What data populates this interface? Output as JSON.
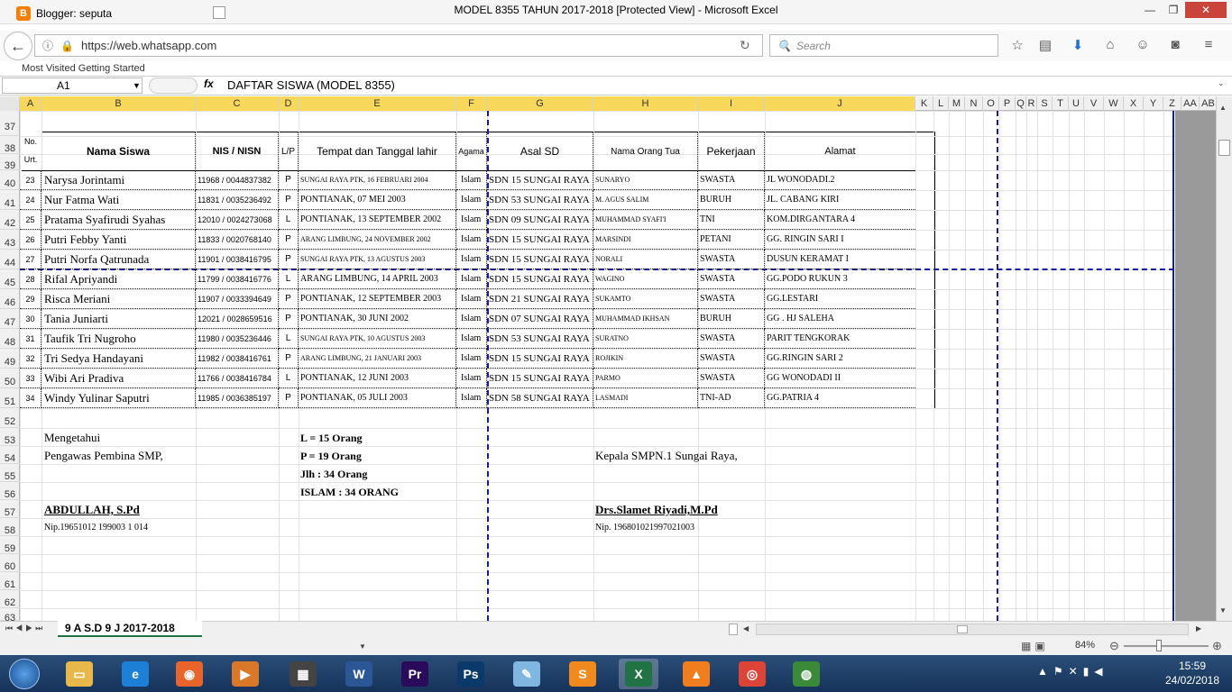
{
  "browser": {
    "tab_title": "Blogger: seputa",
    "url": "https://web.whatsapp.com",
    "search_placeholder": "Search",
    "bookmarks": "Most Visited    Getting Started"
  },
  "window": {
    "title": "MODEL 8355 TAHUN 2017-2018  [Protected View]  -  Microsoft Excel"
  },
  "formula_bar": {
    "cell_ref": "A1",
    "fx": "fx",
    "content": "DAFTAR SISWA (MODEL 8355)"
  },
  "columns": [
    "A",
    "B",
    "C",
    "D",
    "E",
    "F",
    "G",
    "H",
    "I",
    "J",
    "K",
    "L",
    "M",
    "N",
    "O",
    "P",
    "Q",
    "R",
    "S",
    "T",
    "U",
    "V",
    "W",
    "X",
    "Y",
    "Z",
    "AA",
    "AB"
  ],
  "rows": [
    "37",
    "38",
    "39",
    "40",
    "41",
    "42",
    "43",
    "44",
    "45",
    "46",
    "47",
    "48",
    "49",
    "50",
    "51",
    "52",
    "53",
    "54",
    "55",
    "56",
    "57",
    "58",
    "59",
    "60",
    "61",
    "62",
    "63"
  ],
  "table": {
    "headers": {
      "no": "No.",
      "urt": "Urt.",
      "nama": "Nama  Siswa",
      "nis": "NIS / NISN",
      "lp": "L/P",
      "ttl": "Tempat dan Tanggal lahir",
      "agama": "Agama",
      "asal": "Asal SD",
      "ortu": "Nama Orang Tua",
      "pekerjaan": "Pekerjaan",
      "alamat": "Alamat"
    },
    "students": [
      {
        "no": "23",
        "nama": "Narysa Jorintami",
        "nis": "11968 / 0044837382",
        "lp": "P",
        "ttl": "SUNGAI RAYA PTK, 16 FEBRUARI 2004",
        "agama": "Islam",
        "asal": "SDN 15 SUNGAI RAYA",
        "ortu": "SUNARYO",
        "kerja": "SWASTA",
        "alamat": "JL WONODADI.2"
      },
      {
        "no": "24",
        "nama": "Nur Fatma Wati",
        "nis": "11831 / 0035236492",
        "lp": "P",
        "ttl": "PONTIANAK, 07 MEI 2003",
        "agama": "Islam",
        "asal": "SDN 53 SUNGAI RAYA",
        "ortu": "M. AGUS SALIM",
        "kerja": "BURUH",
        "alamat": "JL. CABANG KIRI"
      },
      {
        "no": "25",
        "nama": "Pratama Syafirudi Syahas",
        "nis": "12010 / 0024273068",
        "lp": "L",
        "ttl": "PONTIANAK, 13 SEPTEMBER 2002",
        "agama": "Islam",
        "asal": "SDN 09 SUNGAI RAYA",
        "ortu": "MUHAMMAD SYAFI'I",
        "kerja": "TNI",
        "alamat": "KOM.DIRGANTARA 4"
      },
      {
        "no": "26",
        "nama": "Putri Febby Yanti",
        "nis": "11833 / 0020768140",
        "lp": "P",
        "ttl": "ARANG LIMBUNG, 24 NOVEMBER 2002",
        "agama": "Islam",
        "asal": "SDN 15 SUNGAI RAYA",
        "ortu": "MARSINDI",
        "kerja": "PETANI",
        "alamat": "GG. RINGIN SARI I"
      },
      {
        "no": "27",
        "nama": "Putri Norfa Qatrunada",
        "nis": "11901 / 0038416795",
        "lp": "P",
        "ttl": "SUNGAI RAYA PTK, 13 AGUSTUS 2003",
        "agama": "Islam",
        "asal": "SDN 15 SUNGAI RAYA",
        "ortu": "NORALI",
        "kerja": "SWASTA",
        "alamat": "DUSUN KERAMAT I"
      },
      {
        "no": "28",
        "nama": "Rifal Apriyandi",
        "nis": "11799 / 0038416776",
        "lp": "L",
        "ttl": "ARANG LIMBUNG, 14 APRIL 2003",
        "agama": "Islam",
        "asal": "SDN 15 SUNGAI RAYA",
        "ortu": "WAGINO",
        "kerja": "SWASTA",
        "alamat": "GG.PODO RUKUN 3"
      },
      {
        "no": "29",
        "nama": "Risca Meriani",
        "nis": "11907 / 0033394649",
        "lp": "P",
        "ttl": "PONTIANAK, 12 SEPTEMBER 2003",
        "agama": "Islam",
        "asal": "SDN 21 SUNGAI RAYA",
        "ortu": "SUKAMTO",
        "kerja": "SWASTA",
        "alamat": "GG.LESTARI"
      },
      {
        "no": "30",
        "nama": "Tania Juniarti",
        "nis": "12021 / 0028659516",
        "lp": "P",
        "ttl": "PONTIANAK, 30 JUNI 2002",
        "agama": "Islam",
        "asal": "SDN 07 SUNGAI RAYA",
        "ortu": "MUHAMMAD IKHSAN",
        "kerja": "BURUH",
        "alamat": "GG . HJ SALEHA"
      },
      {
        "no": "31",
        "nama": "Taufik Tri Nugroho",
        "nis": "11980 / 0035236446",
        "lp": "L",
        "ttl": "SUNGAI RAYA PTK, 10 AGUSTUS 2003",
        "agama": "Islam",
        "asal": "SDN 53 SUNGAI RAYA",
        "ortu": "SURATNO",
        "kerja": "SWASTA",
        "alamat": "PARIT TENGKORAK"
      },
      {
        "no": "32",
        "nama": "Tri Sedya Handayani",
        "nis": "11982 / 0038416761",
        "lp": "P",
        "ttl": "ARANG LIMBUNG, 21 JANUARI 2003",
        "agama": "Islam",
        "asal": "SDN 15 SUNGAI RAYA",
        "ortu": "ROJIKIN",
        "kerja": "SWASTA",
        "alamat": "GG.RINGIN SARI 2"
      },
      {
        "no": "33",
        "nama": "Wibi Ari Pradiva",
        "nis": "11766 / 0038416784",
        "lp": "L",
        "ttl": "PONTIANAK, 12 JUNI 2003",
        "agama": "Islam",
        "asal": "SDN 15 SUNGAI RAYA",
        "ortu": "PARMO",
        "kerja": "SWASTA",
        "alamat": "GG WONODADI II"
      },
      {
        "no": "34",
        "nama": "Windy Yulinar Saputri",
        "nis": "11985 / 0036385197",
        "lp": "P",
        "ttl": "PONTIANAK, 05 JULI 2003",
        "agama": "Islam",
        "asal": "SDN 58 SUNGAI RAYA",
        "ortu": "LASMADI",
        "kerja": "TNI-AD",
        "alamat": "GG.PATRIA 4"
      }
    ]
  },
  "footer": {
    "mengetahui": "Mengetahui",
    "pengawas": "Pengawas Pembina SMP,",
    "l_count": "L  =   15   Orang",
    "p_count": "P  =  19   Orang",
    "jlh": "Jlh :  34   Orang",
    "islam": "ISLAM : 34 ORANG",
    "kepala": "Kepala SMPN.1 Sungai Raya,",
    "sig1_name": "ABDULLAH, S.Pd",
    "sig1_nip": "Nip.19651012 199003 1 014",
    "sig2_name": "Drs.Slamet  Riyadi,M.Pd",
    "sig2_nip": "Nip. 196801021997021003"
  },
  "sheet_tab": "9 A S.D 9 J  2017-2018",
  "zoom": "84%",
  "clock": {
    "time": "15:59",
    "date": "24/02/2018"
  },
  "taskbar_apps": [
    "explorer-icon",
    "ie-icon",
    "firefox-icon",
    "media-player-icon",
    "video-icon",
    "word-icon",
    "premiere-icon",
    "photoshop-icon",
    "notepad-icon",
    "sublime-icon",
    "excel-icon",
    "vlc-icon",
    "chrome-icon",
    "network-icon"
  ],
  "colors": {
    "accent": "#217346",
    "dashed": "#1a1a9c",
    "selected_header": "#f7d85a",
    "taskbar": "#1e3f66"
  }
}
